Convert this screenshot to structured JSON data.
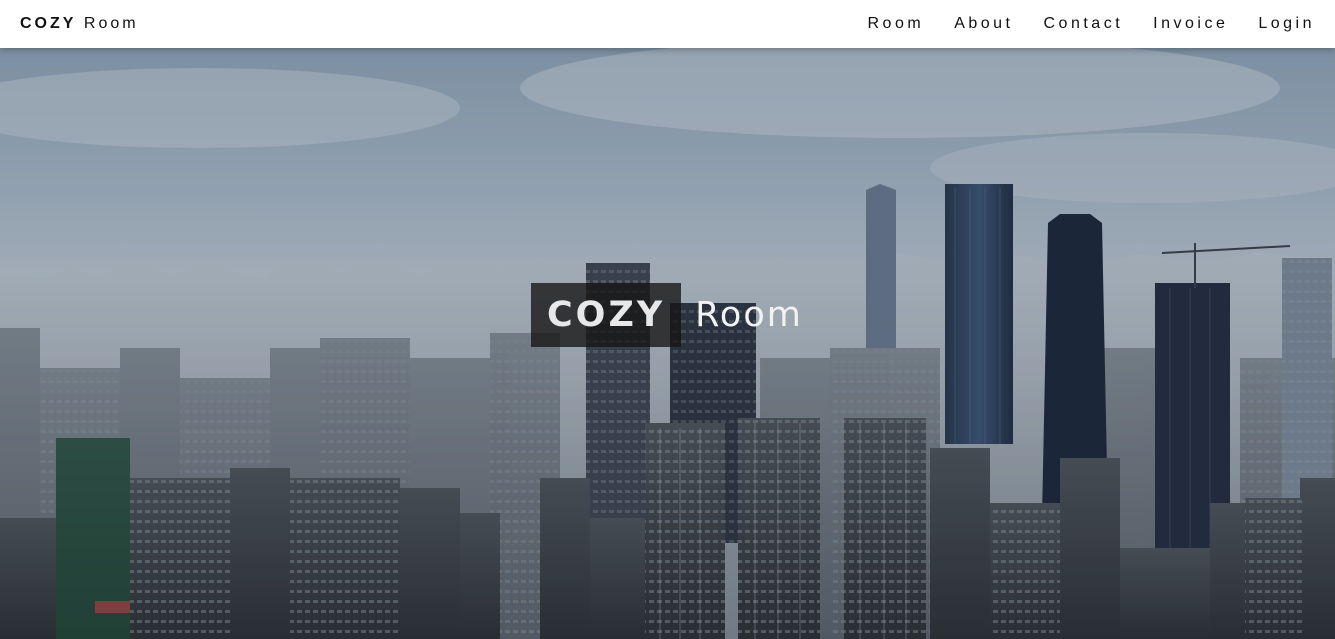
{
  "header": {
    "brand_bold": "COZY",
    "brand_rest": " Room",
    "nav": [
      {
        "label": "Room"
      },
      {
        "label": "About"
      },
      {
        "label": "Contact"
      },
      {
        "label": "Invoice"
      },
      {
        "label": "Login"
      }
    ]
  },
  "hero": {
    "title_bold": "COZY",
    "title_rest": "Room"
  }
}
